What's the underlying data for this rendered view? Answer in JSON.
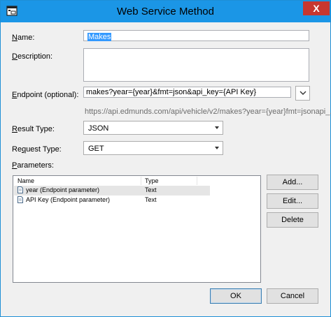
{
  "window": {
    "title": "Web Service Method",
    "close_glyph": "X",
    "accent_color": "#1b96e6"
  },
  "form": {
    "name": {
      "label_u": "N",
      "label_rest": "ame:",
      "value": "Makes"
    },
    "description": {
      "label_u": "D",
      "label_rest": "escription:",
      "value": ""
    },
    "endpoint": {
      "label_u": "E",
      "label_rest": "ndpoint (optional):",
      "value": "makes?year={year}&fmt=json&api_key={API Key}",
      "resolved_url": "https://api.edmunds.com/api/vehicle/v2/makes?year={year}fmt=jsonapi_..."
    },
    "result_type": {
      "label_u": "R",
      "label_rest": "esult Type:",
      "value": "JSON"
    },
    "request_type": {
      "label_pre": "Re",
      "label_u": "q",
      "label_rest": "uest Type:",
      "value": "GET"
    },
    "parameters": {
      "label_u": "P",
      "label_rest": "arameters:"
    }
  },
  "params_table": {
    "columns": [
      "Name",
      "Type"
    ],
    "rows": [
      {
        "name": "year (Endpoint parameter)",
        "type": "Text"
      },
      {
        "name": "API Key (Endpoint parameter)",
        "type": "Text"
      }
    ]
  },
  "buttons": {
    "add": "Add...",
    "edit": "Edit...",
    "delete": "Delete",
    "ok": "OK",
    "cancel": "Cancel"
  }
}
